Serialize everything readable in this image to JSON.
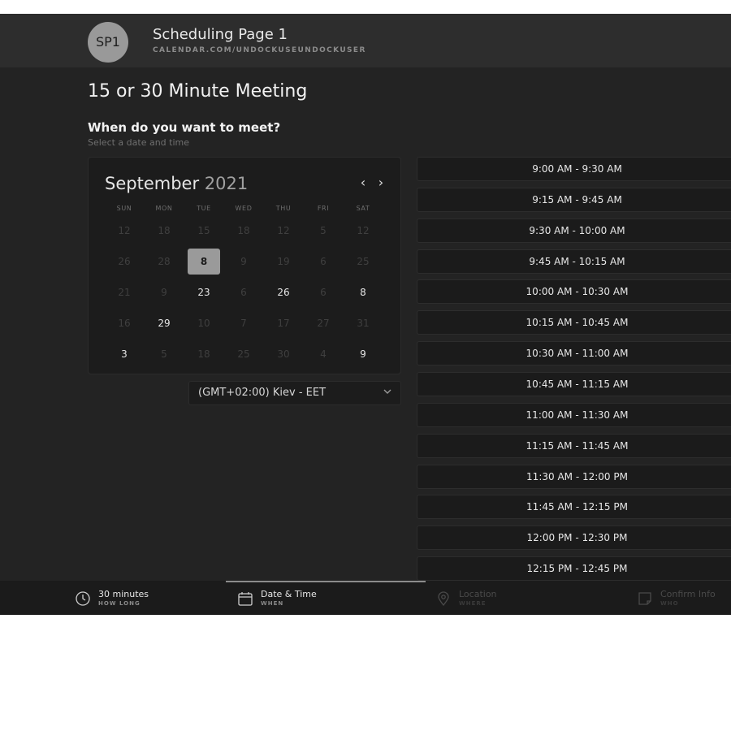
{
  "header": {
    "avatar_initials": "SP1",
    "page_name": "Scheduling Page 1",
    "page_url": "CALENDAR.COM/UNDOCKUSEUNDOCKUSER"
  },
  "meeting_title": "15 or 30 Minute Meeting",
  "question": "When do you want to meet?",
  "sub_question": "Select a date and time",
  "calendar": {
    "month": "September",
    "year": "2021",
    "prev_icon": "‹",
    "next_icon": "›",
    "weekdays": [
      "SUN",
      "MON",
      "TUE",
      "WED",
      "THU",
      "FRI",
      "SAT"
    ],
    "weeks": [
      [
        {
          "d": "12",
          "a": false
        },
        {
          "d": "18",
          "a": false
        },
        {
          "d": "15",
          "a": false
        },
        {
          "d": "18",
          "a": false
        },
        {
          "d": "12",
          "a": false
        },
        {
          "d": "5",
          "a": false
        },
        {
          "d": "12",
          "a": false
        }
      ],
      [
        {
          "d": "26",
          "a": false
        },
        {
          "d": "28",
          "a": false
        },
        {
          "d": "8",
          "a": true,
          "sel": true
        },
        {
          "d": "9",
          "a": false
        },
        {
          "d": "19",
          "a": false
        },
        {
          "d": "6",
          "a": false
        },
        {
          "d": "25",
          "a": false
        }
      ],
      [
        {
          "d": "21",
          "a": false
        },
        {
          "d": "9",
          "a": false
        },
        {
          "d": "23",
          "a": true
        },
        {
          "d": "6",
          "a": false
        },
        {
          "d": "26",
          "a": true
        },
        {
          "d": "6",
          "a": false
        },
        {
          "d": "8",
          "a": true
        }
      ],
      [
        {
          "d": "16",
          "a": false
        },
        {
          "d": "29",
          "a": true
        },
        {
          "d": "10",
          "a": false
        },
        {
          "d": "7",
          "a": false
        },
        {
          "d": "17",
          "a": false
        },
        {
          "d": "27",
          "a": false
        },
        {
          "d": "31",
          "a": false
        }
      ],
      [
        {
          "d": "3",
          "a": true
        },
        {
          "d": "5",
          "a": false
        },
        {
          "d": "18",
          "a": false
        },
        {
          "d": "25",
          "a": false
        },
        {
          "d": "30",
          "a": false
        },
        {
          "d": "4",
          "a": false
        },
        {
          "d": "9",
          "a": true
        }
      ]
    ]
  },
  "timezone": "(GMT+02:00) Kiev - EET",
  "time_slots": [
    "9:00 AM - 9:30 AM",
    "9:15 AM - 9:45 AM",
    "9:30 AM - 10:00 AM",
    "9:45 AM - 10:15 AM",
    "10:00 AM - 10:30 AM",
    "10:15 AM - 10:45 AM",
    "10:30 AM - 11:00 AM",
    "10:45 AM - 11:15 AM",
    "11:00 AM - 11:30 AM",
    "11:15 AM - 11:45 AM",
    "11:30 AM - 12:00 PM",
    "11:45 AM - 12:15 PM",
    "12:00 PM - 12:30 PM",
    "12:15 PM - 12:45 PM"
  ],
  "footer": {
    "steps": [
      {
        "title": "30 minutes",
        "subtitle": "HOW LONG",
        "icon": "clock-icon",
        "active": true
      },
      {
        "title": "Date & Time",
        "subtitle": "WHEN",
        "icon": "calendar-icon",
        "active": true
      },
      {
        "title": "Location",
        "subtitle": "WHERE",
        "icon": "location-pin-icon",
        "active": false
      },
      {
        "title": "Confirm Info",
        "subtitle": "WHO",
        "icon": "note-icon",
        "active": false
      }
    ]
  },
  "colors": {
    "page_background": "#232323",
    "header_background": "#2d2d2d",
    "selected_day": "#9a9a9a",
    "slot_background": "#1b1b1b"
  }
}
